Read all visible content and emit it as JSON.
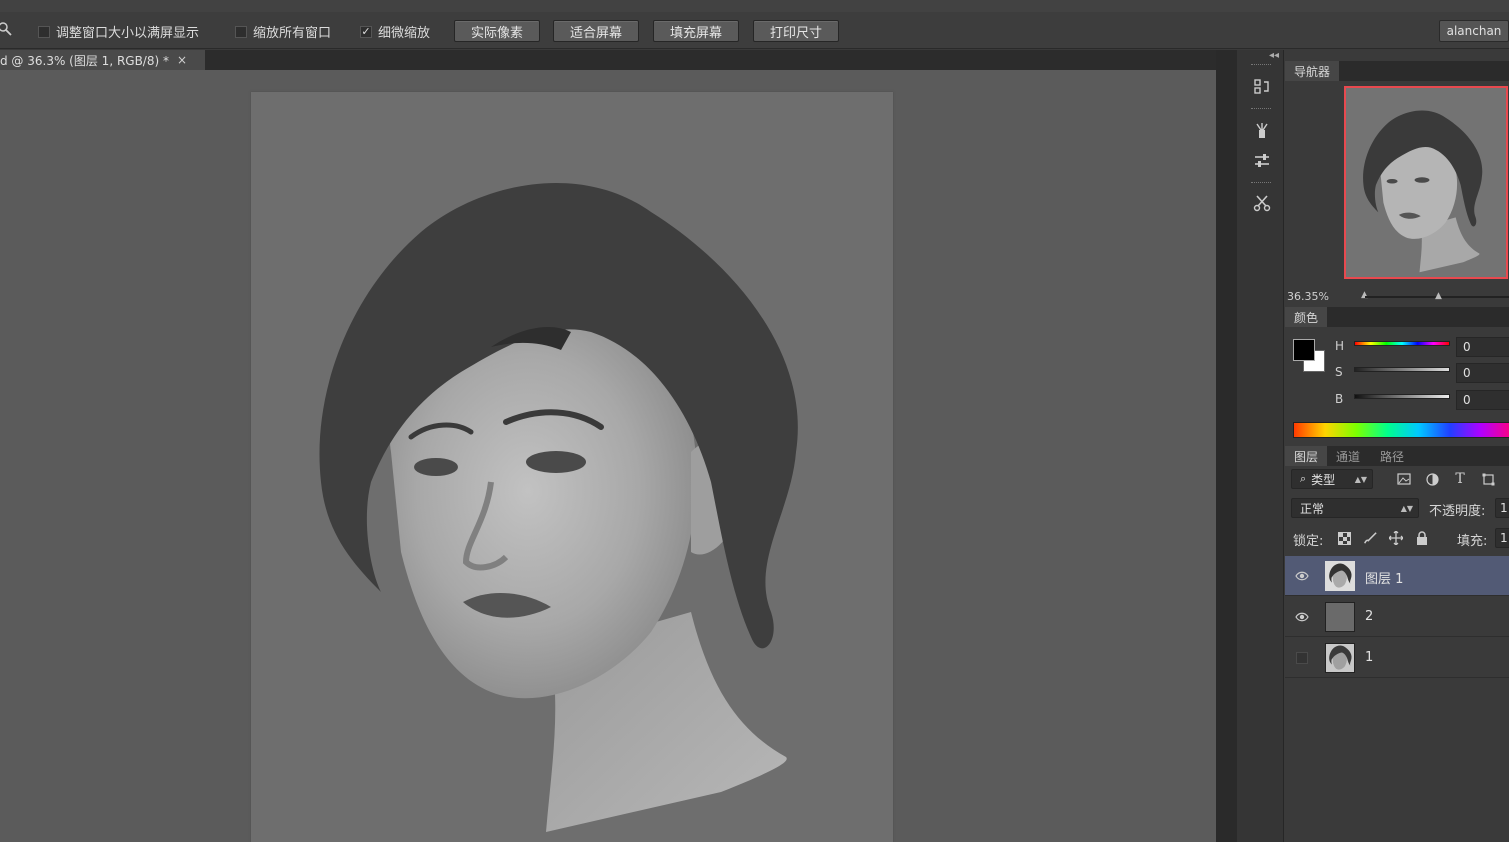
{
  "options_bar": {
    "resize_windows_label": "调整窗口大小以满屏显示",
    "zoom_all_label": "缩放所有窗口",
    "scrubby_zoom_label": "细微缩放",
    "actual_pixels_label": "实际像素",
    "fit_screen_label": "适合屏幕",
    "fill_screen_label": "填充屏幕",
    "print_size_label": "打印尺寸",
    "user_label": "alanchan"
  },
  "document_tab": {
    "title": "d @ 36.3% (图层 1, RGB/8) *",
    "close_glyph": "×"
  },
  "navigator": {
    "tab_label": "导航器",
    "zoom_value": "36.35%"
  },
  "color_panel": {
    "tab_label": "颜色",
    "h_label": "H",
    "s_label": "S",
    "b_label": "B",
    "h_value": "0",
    "s_value": "0",
    "b_value": "0"
  },
  "layers_panel": {
    "tabs": [
      "图层",
      "通道",
      "路径"
    ],
    "filter_label": "类型",
    "blend_mode": "正常",
    "opacity_label": "不透明度:",
    "opacity_value": "1",
    "lock_label": "锁定:",
    "fill_label": "填充:",
    "fill_value": "1",
    "layers": [
      {
        "name": "图层 1",
        "visible": true,
        "selected": true
      },
      {
        "name": "2",
        "visible": true,
        "selected": false
      },
      {
        "name": "1",
        "visible": false,
        "selected": false
      }
    ]
  },
  "colors": {
    "selected_layer": "#525a75",
    "navigator_frame": "#e8494f"
  }
}
